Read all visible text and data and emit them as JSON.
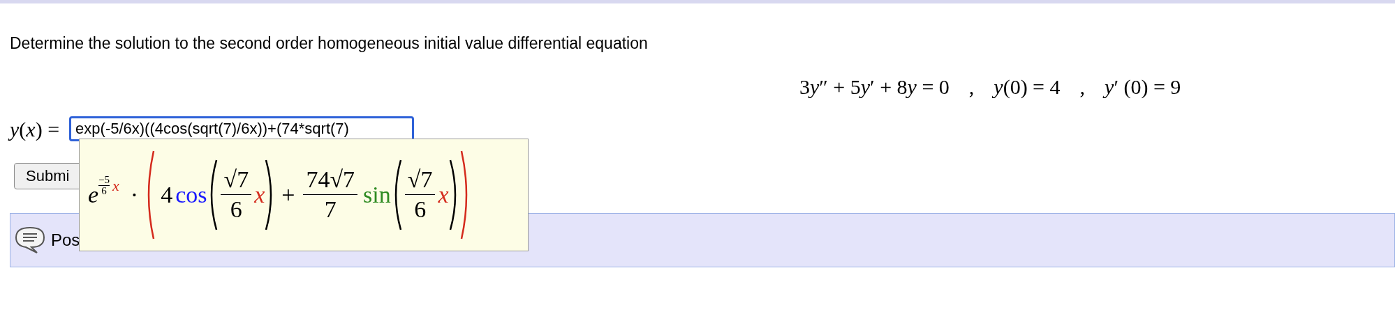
{
  "question": {
    "prompt": "Determine the solution to the second order homogeneous initial value differential equation",
    "equation": [
      [
        {
          "kind": "plain",
          "text": "3"
        },
        {
          "kind": "variable",
          "text": "y"
        },
        {
          "kind": "plain",
          "text": "″ + 5"
        },
        {
          "kind": "variable",
          "text": "y"
        },
        {
          "kind": "plain",
          "text": "′ + 8"
        },
        {
          "kind": "variable",
          "text": "y"
        },
        {
          "kind": "plain",
          "text": " = 0"
        }
      ],
      [
        {
          "kind": "variable",
          "text": "y"
        },
        {
          "kind": "plain",
          "text": "(0) = 4"
        }
      ],
      [
        {
          "kind": "variable",
          "text": "y"
        },
        {
          "kind": "plain",
          "text": "′ (0) = 9"
        }
      ]
    ],
    "separator": ","
  },
  "answer": {
    "label": "*y*(*x*) =",
    "value": "exp(-5/6x)((4cos(sqrt(7)/6x))+(74*sqrt(7)",
    "focused": true
  },
  "preview": {
    "base": "e",
    "exp_num": "−5",
    "exp_den": "6",
    "exp_var": "x",
    "dot": "·",
    "coef": "4",
    "func1": "cos",
    "frac1_num": "√7",
    "frac1_den": "6",
    "var1": "x",
    "plus": "+",
    "frac2_num": "74√7",
    "frac2_den": "7",
    "func2": "sin",
    "frac3_num": "√7",
    "frac3_den": "6",
    "var2": "x"
  },
  "submit_button": "Submi",
  "discussion": {
    "label": "Pos"
  }
}
